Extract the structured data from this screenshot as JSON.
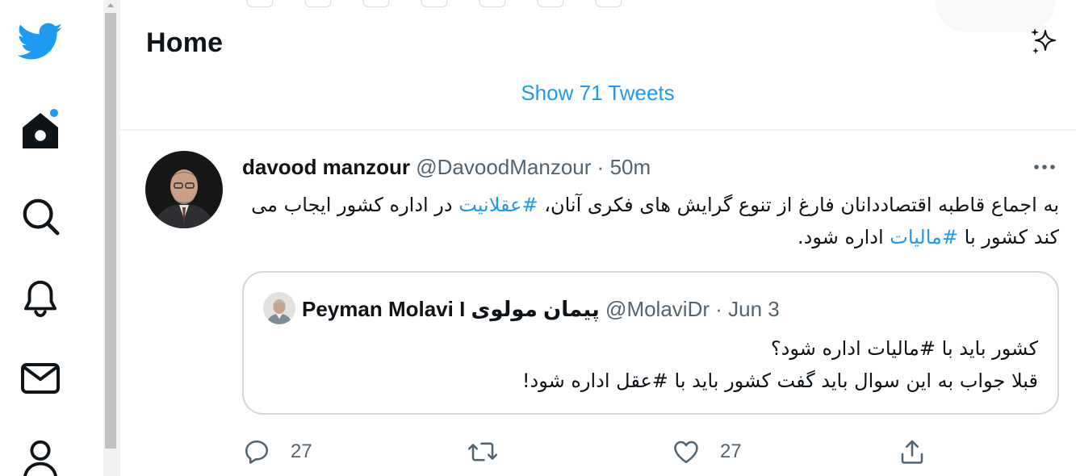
{
  "header": {
    "title": "Home"
  },
  "show_tweets": {
    "label": "Show 71 Tweets"
  },
  "tweet": {
    "author_name": "davood manzour",
    "handle": "@DavoodManzour",
    "time": "50m",
    "text_parts": [
      "به اجماع قاطبه اقتصاددانان فارغ از تنوع گرایش های فکری آنان، ",
      "#عقلانیت",
      " در اداره کشور ایجاب می کند کشور با ",
      "#مالیات",
      " اداره شود."
    ],
    "quote": {
      "author_name": "Peyman Molavi I پیمان مولوی",
      "handle": "@MolaviDr",
      "time": "Jun 3",
      "line1": "کشور باید با #مالیات اداره شود؟",
      "line2": "قبلا جواب به این سوال باید گفت کشور باید با #عقل اداره شود!"
    },
    "actions": {
      "reply_count": "27",
      "like_count": "27"
    }
  },
  "colors": {
    "accent": "#1d9bf0",
    "text": "#0f1419",
    "secondary": "#536471",
    "border": "#cfd9de"
  },
  "icons": [
    "twitter-logo-icon",
    "home-icon",
    "explore-search-icon",
    "notifications-bell-icon",
    "messages-envelope-icon",
    "profile-icon",
    "sparkle-icon",
    "more-icon",
    "reply-icon",
    "retweet-icon",
    "like-icon",
    "share-icon"
  ]
}
